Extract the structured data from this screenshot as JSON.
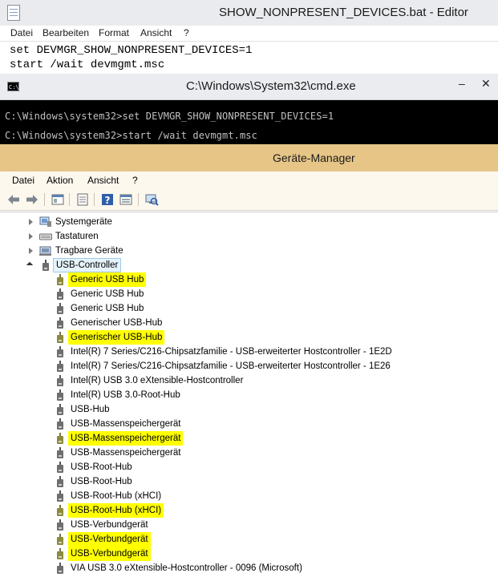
{
  "notepad": {
    "title": "SHOW_NONPRESENT_DEVICES.bat - Editor",
    "menu": [
      "Datei",
      "Bearbeiten",
      "Format",
      "Ansicht",
      "?"
    ],
    "lines": [
      "set DEVMGR_SHOW_NONPRESENT_DEVICES=1",
      "start /wait devmgmt.msc"
    ]
  },
  "console": {
    "title": "C:\\Windows\\System32\\cmd.exe",
    "minimize": "–",
    "close": "✕",
    "lines": [
      "C:\\Windows\\system32>set DEVMGR_SHOW_NONPRESENT_DEVICES=1",
      "C:\\Windows\\system32>start /wait devmgmt.msc"
    ]
  },
  "device_manager": {
    "title": "Geräte-Manager",
    "menu": [
      "Datei",
      "Aktion",
      "Ansicht",
      "?"
    ],
    "toolbar_icons": [
      "back-arrow-icon",
      "forward-arrow-icon",
      "console-tree-icon",
      "properties-icon",
      "help-icon",
      "view-icon",
      "scan-hardware-icon"
    ],
    "categories": [
      {
        "label": "Systemgeräte",
        "expanded": false,
        "icon": "system-devices-icon"
      },
      {
        "label": "Tastaturen",
        "expanded": false,
        "icon": "keyboard-icon"
      },
      {
        "label": "Tragbare Geräte",
        "expanded": false,
        "icon": "portable-devices-icon"
      },
      {
        "label": "USB-Controller",
        "expanded": true,
        "icon": "usb-icon",
        "selected": true
      }
    ],
    "usb_devices": [
      {
        "label": "Generic USB Hub",
        "highlighted": true
      },
      {
        "label": "Generic USB Hub",
        "highlighted": false
      },
      {
        "label": "Generic USB Hub",
        "highlighted": false
      },
      {
        "label": "Generischer USB-Hub",
        "highlighted": false
      },
      {
        "label": "Generischer USB-Hub",
        "highlighted": true
      },
      {
        "label": "Intel(R) 7 Series/C216-Chipsatzfamilie - USB-erweiterter Hostcontroller - 1E2D",
        "highlighted": false
      },
      {
        "label": "Intel(R) 7 Series/C216-Chipsatzfamilie - USB-erweiterter Hostcontroller - 1E26",
        "highlighted": false
      },
      {
        "label": "Intel(R) USB 3.0 eXtensible-Hostcontroller",
        "highlighted": false
      },
      {
        "label": "Intel(R) USB 3.0-Root-Hub",
        "highlighted": false
      },
      {
        "label": "USB-Hub",
        "highlighted": false
      },
      {
        "label": "USB-Massenspeichergerät",
        "highlighted": false
      },
      {
        "label": "USB-Massenspeichergerät",
        "highlighted": true
      },
      {
        "label": "USB-Massenspeichergerät",
        "highlighted": false
      },
      {
        "label": "USB-Root-Hub",
        "highlighted": false
      },
      {
        "label": "USB-Root-Hub",
        "highlighted": false
      },
      {
        "label": "USB-Root-Hub (xHCI)",
        "highlighted": false
      },
      {
        "label": "USB-Root-Hub (xHCI)",
        "highlighted": true
      },
      {
        "label": "USB-Verbundgerät",
        "highlighted": false
      },
      {
        "label": "USB-Verbundgerät",
        "highlighted": true
      },
      {
        "label": "USB-Verbundgerät",
        "highlighted": true
      },
      {
        "label": "VIA USB 3.0 eXtensible-Hostcontroller - 0096 (Microsoft)",
        "highlighted": false
      }
    ],
    "colors": {
      "title_bar": "#e6c587",
      "highlight": "#ffff00"
    }
  }
}
